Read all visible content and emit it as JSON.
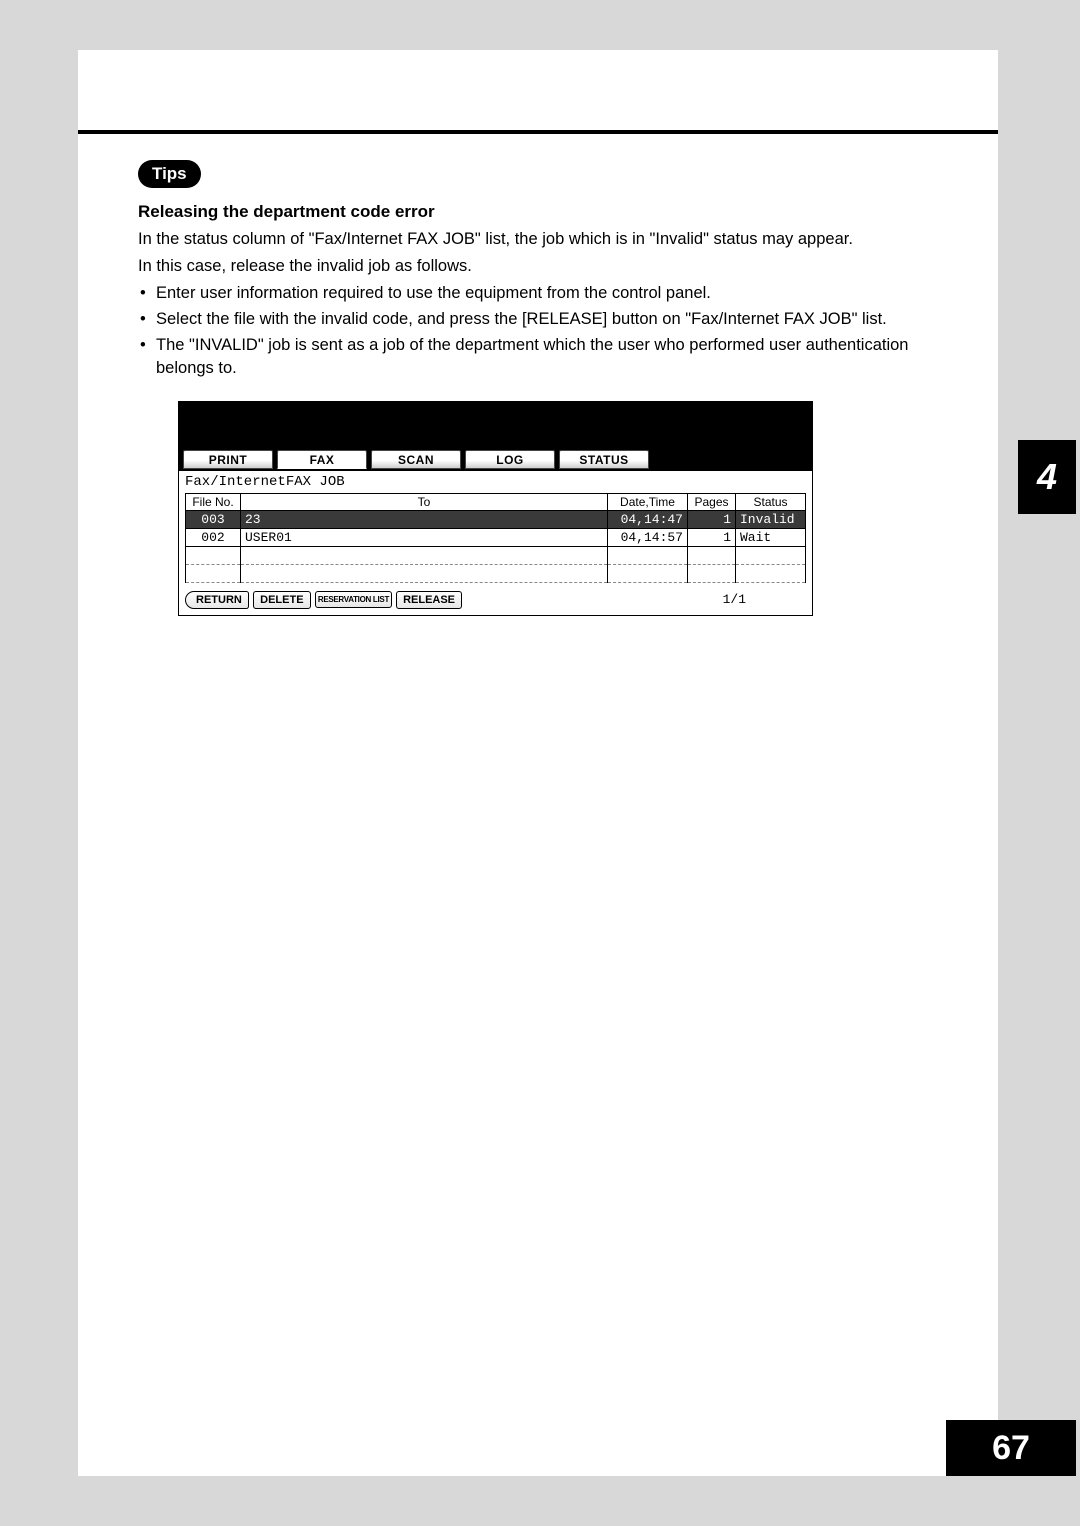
{
  "tips_label": "Tips",
  "subheading": "Releasing the department code error",
  "para1": "In the status column of \"Fax/Internet FAX JOB\" list, the job which is in \"Invalid\" status may appear.",
  "para2": "In this case, release the invalid job as follows.",
  "bullets": [
    "Enter user information required to use the equipment from the control panel.",
    "Select the file with the invalid code, and press the [RELEASE] button on \"Fax/Internet FAX JOB\" list.",
    "The \"INVALID\" job is sent as a job of the department which the user who performed user authentication belongs to."
  ],
  "screen": {
    "tabs": [
      "PRINT",
      "FAX",
      "SCAN",
      "LOG",
      "STATUS"
    ],
    "subtitle": "Fax/InternetFAX JOB",
    "headers": {
      "file": "File No.",
      "to": "To",
      "datetime": "Date,Time",
      "pages": "Pages",
      "status": "Status"
    },
    "rows": [
      {
        "file": "003",
        "to": "23",
        "datetime": "04,14:47",
        "pages": "1",
        "status": "Invalid",
        "selected": true
      },
      {
        "file": "002",
        "to": "USER01",
        "datetime": "04,14:57",
        "pages": "1",
        "status": "Wait",
        "selected": false
      }
    ],
    "buttons": {
      "return": "RETURN",
      "delete": "DELETE",
      "reservation": "RESERVATION LIST",
      "release": "RELEASE"
    },
    "page_indicator": "1/1"
  },
  "chapter": "4",
  "page_number": "67"
}
